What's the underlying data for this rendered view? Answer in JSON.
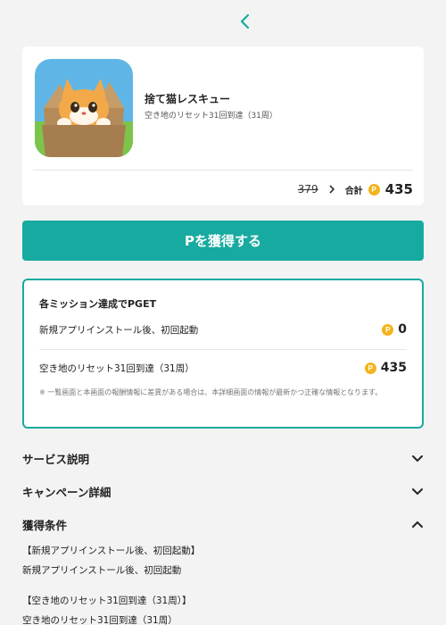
{
  "nav": {
    "back_icon": "chevron-left-icon"
  },
  "app": {
    "name": "捨て猫レスキュー",
    "subtitle": "空き地のリセット31回到達（31周）",
    "old_price": "379",
    "total_label": "合計",
    "coin_symbol": "P",
    "total_value": "435"
  },
  "get_button_label": "Pを獲得する",
  "missions": {
    "title": "各ミッション達成でPGET",
    "items": [
      {
        "label": "新規アプリインストール後、初回起動",
        "points": "0"
      },
      {
        "label": "空き地のリセット31回到達（31周）",
        "points": "435"
      }
    ],
    "note": "※ 一覧画面と本画面の報酬情報に差異がある場合は、本詳細画面の情報が最新かつ正確な情報となります。"
  },
  "sections": [
    {
      "title": "サービス説明",
      "state": "collapsed"
    },
    {
      "title": "キャンペーン詳細",
      "state": "collapsed"
    },
    {
      "title": "獲得条件",
      "state": "expanded"
    }
  ],
  "conditions": [
    {
      "heading": "【新規アプリインストール後、初回起動】",
      "body": "新規アプリインストール後、初回起動"
    },
    {
      "heading": "【空き地のリセット31回到達（31周）】",
      "body": "空き地のリセット31回到達（31周）"
    }
  ],
  "colors": {
    "accent": "#17aaa0",
    "coin": "#f2b51d",
    "background": "#f3f3f3"
  }
}
